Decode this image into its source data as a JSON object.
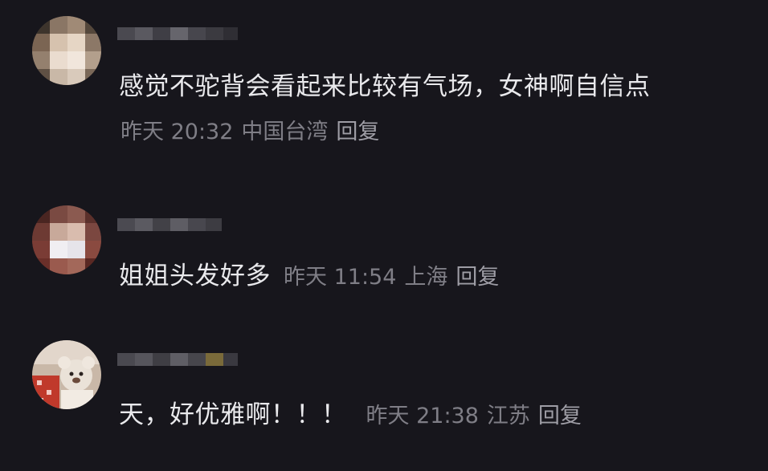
{
  "comments": [
    {
      "avatar": {
        "icon": "avatar-blurred-portrait"
      },
      "username": {
        "icon": "username-pixelated"
      },
      "content": "感觉不驼背会看起来比较有气场，女神啊自信点",
      "meta": {
        "time": "昨天 20:32",
        "location": "中国台湾",
        "reply": "回复"
      }
    },
    {
      "avatar": {
        "icon": "avatar-blurred-figure"
      },
      "username": {
        "icon": "username-pixelated"
      },
      "content": "姐姐头发好多",
      "meta": {
        "time": "昨天 11:54",
        "location": "上海",
        "reply": "回复"
      }
    },
    {
      "avatar": {
        "icon": "avatar-teddy-bear"
      },
      "username": {
        "icon": "username-pixelated"
      },
      "content": "天，好优雅啊！！！",
      "meta": {
        "time": "昨天 21:38",
        "location": "江苏",
        "reply": "回复"
      }
    }
  ],
  "colors": {
    "background": "#17161c",
    "content_text": "#e9e9ec",
    "meta_text": "#7f7e86",
    "reply_text": "#9e9da5"
  }
}
